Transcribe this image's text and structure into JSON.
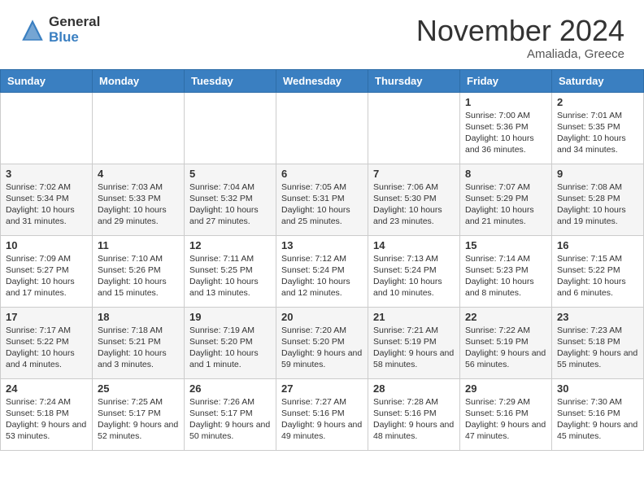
{
  "header": {
    "logo_general": "General",
    "logo_blue": "Blue",
    "month_title": "November 2024",
    "subtitle": "Amaliada, Greece"
  },
  "days_of_week": [
    "Sunday",
    "Monday",
    "Tuesday",
    "Wednesday",
    "Thursday",
    "Friday",
    "Saturday"
  ],
  "weeks": [
    [
      {
        "day": "",
        "content": ""
      },
      {
        "day": "",
        "content": ""
      },
      {
        "day": "",
        "content": ""
      },
      {
        "day": "",
        "content": ""
      },
      {
        "day": "",
        "content": ""
      },
      {
        "day": "1",
        "content": "Sunrise: 7:00 AM\nSunset: 5:36 PM\nDaylight: 10 hours\nand 36 minutes."
      },
      {
        "day": "2",
        "content": "Sunrise: 7:01 AM\nSunset: 5:35 PM\nDaylight: 10 hours\nand 34 minutes."
      }
    ],
    [
      {
        "day": "3",
        "content": "Sunrise: 7:02 AM\nSunset: 5:34 PM\nDaylight: 10 hours\nand 31 minutes."
      },
      {
        "day": "4",
        "content": "Sunrise: 7:03 AM\nSunset: 5:33 PM\nDaylight: 10 hours\nand 29 minutes."
      },
      {
        "day": "5",
        "content": "Sunrise: 7:04 AM\nSunset: 5:32 PM\nDaylight: 10 hours\nand 27 minutes."
      },
      {
        "day": "6",
        "content": "Sunrise: 7:05 AM\nSunset: 5:31 PM\nDaylight: 10 hours\nand 25 minutes."
      },
      {
        "day": "7",
        "content": "Sunrise: 7:06 AM\nSunset: 5:30 PM\nDaylight: 10 hours\nand 23 minutes."
      },
      {
        "day": "8",
        "content": "Sunrise: 7:07 AM\nSunset: 5:29 PM\nDaylight: 10 hours\nand 21 minutes."
      },
      {
        "day": "9",
        "content": "Sunrise: 7:08 AM\nSunset: 5:28 PM\nDaylight: 10 hours\nand 19 minutes."
      }
    ],
    [
      {
        "day": "10",
        "content": "Sunrise: 7:09 AM\nSunset: 5:27 PM\nDaylight: 10 hours\nand 17 minutes."
      },
      {
        "day": "11",
        "content": "Sunrise: 7:10 AM\nSunset: 5:26 PM\nDaylight: 10 hours\nand 15 minutes."
      },
      {
        "day": "12",
        "content": "Sunrise: 7:11 AM\nSunset: 5:25 PM\nDaylight: 10 hours\nand 13 minutes."
      },
      {
        "day": "13",
        "content": "Sunrise: 7:12 AM\nSunset: 5:24 PM\nDaylight: 10 hours\nand 12 minutes."
      },
      {
        "day": "14",
        "content": "Sunrise: 7:13 AM\nSunset: 5:24 PM\nDaylight: 10 hours\nand 10 minutes."
      },
      {
        "day": "15",
        "content": "Sunrise: 7:14 AM\nSunset: 5:23 PM\nDaylight: 10 hours\nand 8 minutes."
      },
      {
        "day": "16",
        "content": "Sunrise: 7:15 AM\nSunset: 5:22 PM\nDaylight: 10 hours\nand 6 minutes."
      }
    ],
    [
      {
        "day": "17",
        "content": "Sunrise: 7:17 AM\nSunset: 5:22 PM\nDaylight: 10 hours\nand 4 minutes."
      },
      {
        "day": "18",
        "content": "Sunrise: 7:18 AM\nSunset: 5:21 PM\nDaylight: 10 hours\nand 3 minutes."
      },
      {
        "day": "19",
        "content": "Sunrise: 7:19 AM\nSunset: 5:20 PM\nDaylight: 10 hours\nand 1 minute."
      },
      {
        "day": "20",
        "content": "Sunrise: 7:20 AM\nSunset: 5:20 PM\nDaylight: 9 hours\nand 59 minutes."
      },
      {
        "day": "21",
        "content": "Sunrise: 7:21 AM\nSunset: 5:19 PM\nDaylight: 9 hours\nand 58 minutes."
      },
      {
        "day": "22",
        "content": "Sunrise: 7:22 AM\nSunset: 5:19 PM\nDaylight: 9 hours\nand 56 minutes."
      },
      {
        "day": "23",
        "content": "Sunrise: 7:23 AM\nSunset: 5:18 PM\nDaylight: 9 hours\nand 55 minutes."
      }
    ],
    [
      {
        "day": "24",
        "content": "Sunrise: 7:24 AM\nSunset: 5:18 PM\nDaylight: 9 hours\nand 53 minutes."
      },
      {
        "day": "25",
        "content": "Sunrise: 7:25 AM\nSunset: 5:17 PM\nDaylight: 9 hours\nand 52 minutes."
      },
      {
        "day": "26",
        "content": "Sunrise: 7:26 AM\nSunset: 5:17 PM\nDaylight: 9 hours\nand 50 minutes."
      },
      {
        "day": "27",
        "content": "Sunrise: 7:27 AM\nSunset: 5:16 PM\nDaylight: 9 hours\nand 49 minutes."
      },
      {
        "day": "28",
        "content": "Sunrise: 7:28 AM\nSunset: 5:16 PM\nDaylight: 9 hours\nand 48 minutes."
      },
      {
        "day": "29",
        "content": "Sunrise: 7:29 AM\nSunset: 5:16 PM\nDaylight: 9 hours\nand 47 minutes."
      },
      {
        "day": "30",
        "content": "Sunrise: 7:30 AM\nSunset: 5:16 PM\nDaylight: 9 hours\nand 45 minutes."
      }
    ]
  ]
}
